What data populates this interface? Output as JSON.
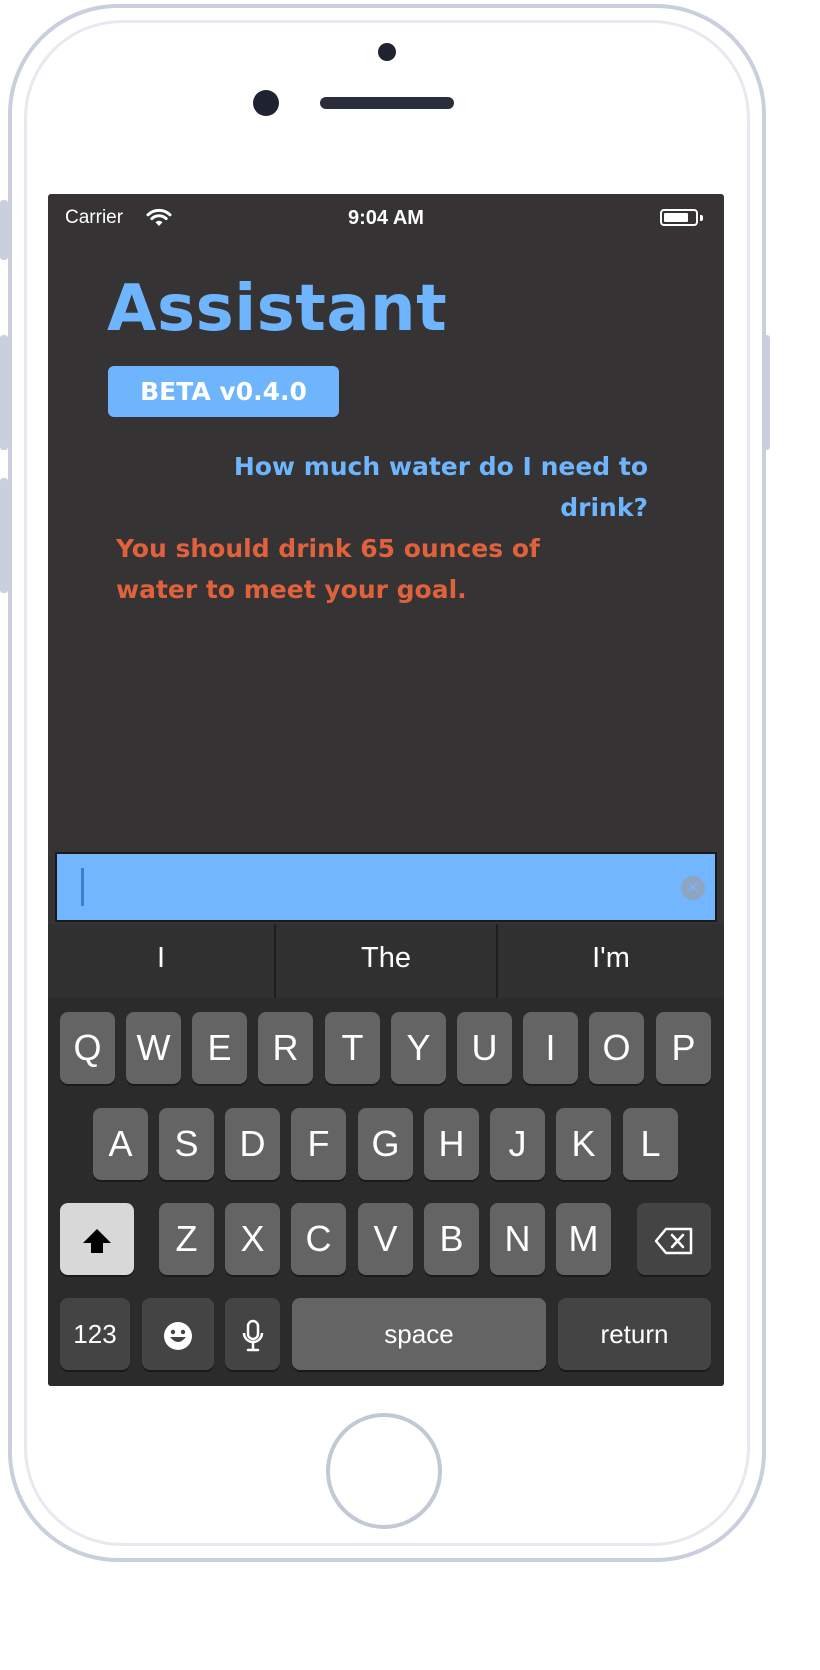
{
  "status_bar": {
    "carrier": "Carrier",
    "time": "9:04 AM"
  },
  "app": {
    "title": "Assistant",
    "version_badge": "BETA v0.4.0",
    "accent_color": "#6eb5fe",
    "reply_color": "#e0623c"
  },
  "conversation": [
    {
      "role": "user",
      "text": "How much water do I need to drink?"
    },
    {
      "role": "assistant",
      "text": "You should drink 65 ounces of water to meet your goal."
    }
  ],
  "input": {
    "value": "",
    "clear_icon": "clear-circle-icon"
  },
  "keyboard": {
    "suggestions": [
      "I",
      "The",
      "I'm"
    ],
    "row1": [
      "Q",
      "W",
      "E",
      "R",
      "T",
      "Y",
      "U",
      "I",
      "O",
      "P"
    ],
    "row2": [
      "A",
      "S",
      "D",
      "F",
      "G",
      "H",
      "J",
      "K",
      "L"
    ],
    "row3": [
      "Z",
      "X",
      "C",
      "V",
      "B",
      "N",
      "M"
    ],
    "numbers_label": "123",
    "space_label": "space",
    "return_label": "return",
    "shift_icon": "shift-arrow-icon",
    "delete_icon": "backspace-icon",
    "emoji_icon": "emoji-icon",
    "mic_icon": "microphone-icon"
  }
}
